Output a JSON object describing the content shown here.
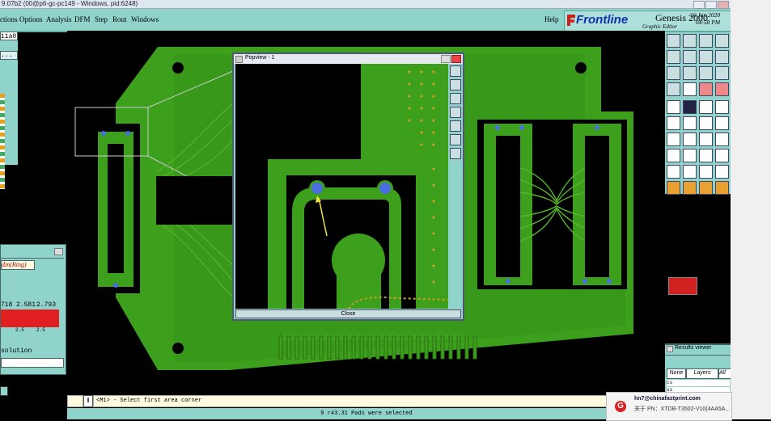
{
  "window": {
    "title": "9.07b2 (00@p6-gc-pc149 - Windows, pid:6248)"
  },
  "menu": {
    "items": [
      "ctions",
      "Options",
      "Analysis",
      "DFM",
      "Step",
      "Rout",
      "Windows"
    ],
    "help": "Help"
  },
  "logo": {
    "brand": "Frontline",
    "product": "Genesis 2000",
    "subtitle": "Graphic Editor",
    "date": "16 Jan 2020",
    "time": "04:58 PM"
  },
  "left_panel": {
    "field": "11a0",
    "dots": "..."
  },
  "sidebar": {
    "mode": "din(Ring)",
    "values": [
      "718",
      "2.581",
      "2.793"
    ],
    "bars": [
      "",
      "2.5",
      "2.5"
    ],
    "label": "solution"
  },
  "popview": {
    "title": "Popview - 1",
    "close_label": "Close"
  },
  "status": {
    "prompt": "<M1> - Select first area corner",
    "message": "9 r43.31 Pads were selected"
  },
  "results": {
    "title": "Results viewer",
    "tabs": [
      "None",
      "Layers",
      "All"
    ],
    "rows": [
      "cs",
      "ss",
      "Re"
    ]
  },
  "notification": {
    "email": "hn7@chinafastprint.com",
    "text": "关于 PN：XTDB-T3502-V10(4AA5A..."
  },
  "colors": {
    "menu_bg": "#8fd3cb",
    "board_green": "#3da01c",
    "copper_green": "#56b52a",
    "pad_blue": "#4a6ee0",
    "status_bg": "#fffbe0",
    "brand_blue": "#1030b0"
  }
}
